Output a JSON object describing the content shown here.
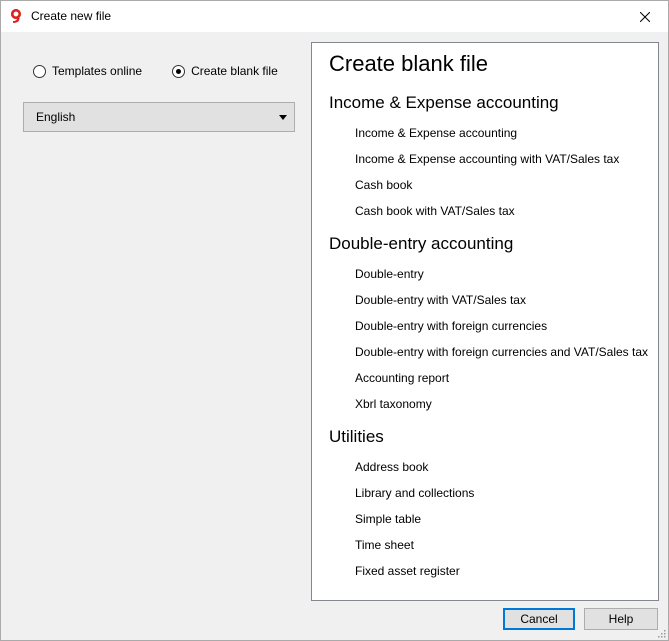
{
  "window": {
    "title": "Create new file"
  },
  "source": {
    "options": [
      {
        "label": "Templates online",
        "checked": false
      },
      {
        "label": "Create blank file",
        "checked": true
      }
    ]
  },
  "language": {
    "selected": "English"
  },
  "panel": {
    "title": "Create blank file",
    "sections": [
      {
        "heading": "Income & Expense accounting",
        "items": [
          "Income & Expense accounting",
          "Income & Expense accounting with VAT/Sales tax",
          "Cash book",
          "Cash book with VAT/Sales tax"
        ]
      },
      {
        "heading": "Double-entry accounting",
        "items": [
          "Double-entry",
          "Double-entry with VAT/Sales tax",
          "Double-entry with foreign currencies",
          "Double-entry with foreign currencies and VAT/Sales tax",
          "Accounting report",
          "Xbrl taxonomy"
        ]
      },
      {
        "heading": "Utilities",
        "items": [
          "Address book",
          "Library and collections",
          "Simple table",
          "Time sheet",
          "Fixed asset register"
        ]
      }
    ]
  },
  "buttons": {
    "cancel": "Cancel",
    "help": "Help"
  },
  "colors": {
    "accent": "#0078d7",
    "icon_red": "#d9232e",
    "icon_yellow": "#f7b500"
  },
  "icons": {
    "app": "banana-app-icon",
    "close": "close-icon",
    "dropdown": "chevron-down-icon"
  }
}
